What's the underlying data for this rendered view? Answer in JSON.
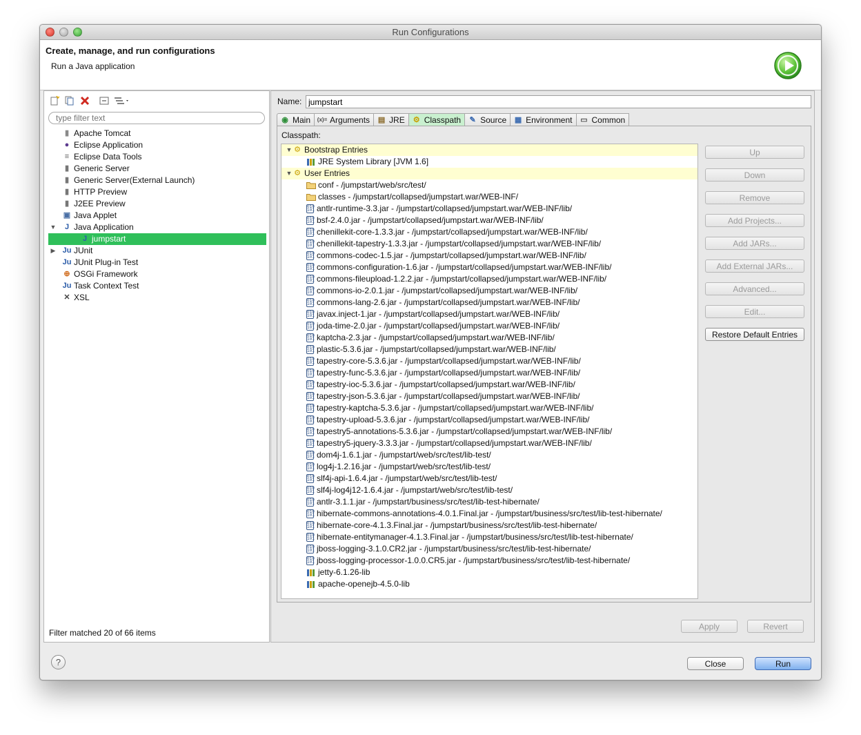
{
  "window": {
    "title": "Run Configurations"
  },
  "header": {
    "title": "Create, manage, and run configurations",
    "subtitle": "Run a Java application",
    "run_icon": "run-icon"
  },
  "sidebar": {
    "toolbar_icons": [
      "new-config-icon",
      "duplicate-icon",
      "delete-icon",
      "collapse-all-icon",
      "filter-icon"
    ],
    "filter_placeholder": "type filter text",
    "items": [
      {
        "label": "Apache Tomcat",
        "icon": "tomcat-icon",
        "level": 0,
        "twisty": ""
      },
      {
        "label": "Eclipse Application",
        "icon": "eclipse-icon",
        "level": 0,
        "twisty": ""
      },
      {
        "label": "Eclipse Data Tools",
        "icon": "database-icon",
        "level": 0,
        "twisty": ""
      },
      {
        "label": "Generic Server",
        "icon": "server-icon",
        "level": 0,
        "twisty": ""
      },
      {
        "label": "Generic Server(External Launch)",
        "icon": "server-icon",
        "level": 0,
        "twisty": ""
      },
      {
        "label": "HTTP Preview",
        "icon": "server-icon",
        "level": 0,
        "twisty": ""
      },
      {
        "label": "J2EE Preview",
        "icon": "server-icon",
        "level": 0,
        "twisty": ""
      },
      {
        "label": "Java Applet",
        "icon": "applet-icon",
        "level": 0,
        "twisty": ""
      },
      {
        "label": "Java Application",
        "icon": "java-app-icon",
        "level": 0,
        "twisty": "▼"
      },
      {
        "label": "jumpstart",
        "icon": "java-app-icon",
        "level": 1,
        "twisty": "",
        "selected": true
      },
      {
        "label": "JUnit",
        "icon": "junit-icon",
        "level": 0,
        "twisty": "▶"
      },
      {
        "label": "JUnit Plug-in Test",
        "icon": "junit-plugin-icon",
        "level": 0,
        "twisty": ""
      },
      {
        "label": "OSGi Framework",
        "icon": "osgi-icon",
        "level": 0,
        "twisty": ""
      },
      {
        "label": "Task Context Test",
        "icon": "junit-icon",
        "level": 0,
        "twisty": ""
      },
      {
        "label": "XSL",
        "icon": "xsl-icon",
        "level": 0,
        "twisty": ""
      }
    ],
    "filter_status": "Filter matched 20 of 66 items"
  },
  "main": {
    "name_label": "Name:",
    "name_value": "jumpstart",
    "tabs": [
      {
        "label": "Main",
        "icon": "main-tab-icon"
      },
      {
        "label": "Arguments",
        "icon": "arguments-icon"
      },
      {
        "label": "JRE",
        "icon": "jre-icon"
      },
      {
        "label": "Classpath",
        "icon": "classpath-icon",
        "active": true
      },
      {
        "label": "Source",
        "icon": "source-icon"
      },
      {
        "label": "Environment",
        "icon": "environment-icon"
      },
      {
        "label": "Common",
        "icon": "common-icon"
      }
    ],
    "classpath_label": "Classpath:",
    "entries": [
      {
        "label": "Bootstrap Entries",
        "kind": "group"
      },
      {
        "label": "JRE System Library [JVM 1.6]",
        "kind": "lib"
      },
      {
        "label": "User Entries",
        "kind": "group"
      },
      {
        "label": "conf - /jumpstart/web/src/test/",
        "kind": "folder"
      },
      {
        "label": "classes - /jumpstart/collapsed/jumpstart.war/WEB-INF/",
        "kind": "folder"
      },
      {
        "label": "antlr-runtime-3.3.jar - /jumpstart/collapsed/jumpstart.war/WEB-INF/lib/",
        "kind": "jar"
      },
      {
        "label": "bsf-2.4.0.jar - /jumpstart/collapsed/jumpstart.war/WEB-INF/lib/",
        "kind": "jar"
      },
      {
        "label": "chenillekit-core-1.3.3.jar - /jumpstart/collapsed/jumpstart.war/WEB-INF/lib/",
        "kind": "jar"
      },
      {
        "label": "chenillekit-tapestry-1.3.3.jar - /jumpstart/collapsed/jumpstart.war/WEB-INF/lib/",
        "kind": "jar"
      },
      {
        "label": "commons-codec-1.5.jar - /jumpstart/collapsed/jumpstart.war/WEB-INF/lib/",
        "kind": "jar"
      },
      {
        "label": "commons-configuration-1.6.jar - /jumpstart/collapsed/jumpstart.war/WEB-INF/lib/",
        "kind": "jar"
      },
      {
        "label": "commons-fileupload-1.2.2.jar - /jumpstart/collapsed/jumpstart.war/WEB-INF/lib/",
        "kind": "jar"
      },
      {
        "label": "commons-io-2.0.1.jar - /jumpstart/collapsed/jumpstart.war/WEB-INF/lib/",
        "kind": "jar"
      },
      {
        "label": "commons-lang-2.6.jar - /jumpstart/collapsed/jumpstart.war/WEB-INF/lib/",
        "kind": "jar"
      },
      {
        "label": "javax.inject-1.jar - /jumpstart/collapsed/jumpstart.war/WEB-INF/lib/",
        "kind": "jar"
      },
      {
        "label": "joda-time-2.0.jar - /jumpstart/collapsed/jumpstart.war/WEB-INF/lib/",
        "kind": "jar"
      },
      {
        "label": "kaptcha-2.3.jar - /jumpstart/collapsed/jumpstart.war/WEB-INF/lib/",
        "kind": "jar"
      },
      {
        "label": "plastic-5.3.6.jar - /jumpstart/collapsed/jumpstart.war/WEB-INF/lib/",
        "kind": "jar"
      },
      {
        "label": "tapestry-core-5.3.6.jar - /jumpstart/collapsed/jumpstart.war/WEB-INF/lib/",
        "kind": "jar"
      },
      {
        "label": "tapestry-func-5.3.6.jar - /jumpstart/collapsed/jumpstart.war/WEB-INF/lib/",
        "kind": "jar"
      },
      {
        "label": "tapestry-ioc-5.3.6.jar - /jumpstart/collapsed/jumpstart.war/WEB-INF/lib/",
        "kind": "jar"
      },
      {
        "label": "tapestry-json-5.3.6.jar - /jumpstart/collapsed/jumpstart.war/WEB-INF/lib/",
        "kind": "jar"
      },
      {
        "label": "tapestry-kaptcha-5.3.6.jar - /jumpstart/collapsed/jumpstart.war/WEB-INF/lib/",
        "kind": "jar"
      },
      {
        "label": "tapestry-upload-5.3.6.jar - /jumpstart/collapsed/jumpstart.war/WEB-INF/lib/",
        "kind": "jar"
      },
      {
        "label": "tapestry5-annotations-5.3.6.jar - /jumpstart/collapsed/jumpstart.war/WEB-INF/lib/",
        "kind": "jar"
      },
      {
        "label": "tapestry5-jquery-3.3.3.jar - /jumpstart/collapsed/jumpstart.war/WEB-INF/lib/",
        "kind": "jar"
      },
      {
        "label": "dom4j-1.6.1.jar - /jumpstart/web/src/test/lib-test/",
        "kind": "jar"
      },
      {
        "label": "log4j-1.2.16.jar - /jumpstart/web/src/test/lib-test/",
        "kind": "jar"
      },
      {
        "label": "slf4j-api-1.6.4.jar - /jumpstart/web/src/test/lib-test/",
        "kind": "jar"
      },
      {
        "label": "slf4j-log4j12-1.6.4.jar - /jumpstart/web/src/test/lib-test/",
        "kind": "jar"
      },
      {
        "label": "antlr-3.1.1.jar - /jumpstart/business/src/test/lib-test-hibernate/",
        "kind": "jar"
      },
      {
        "label": "hibernate-commons-annotations-4.0.1.Final.jar - /jumpstart/business/src/test/lib-test-hibernate/",
        "kind": "jar"
      },
      {
        "label": "hibernate-core-4.1.3.Final.jar - /jumpstart/business/src/test/lib-test-hibernate/",
        "kind": "jar"
      },
      {
        "label": "hibernate-entitymanager-4.1.3.Final.jar - /jumpstart/business/src/test/lib-test-hibernate/",
        "kind": "jar"
      },
      {
        "label": "jboss-logging-3.1.0.CR2.jar - /jumpstart/business/src/test/lib-test-hibernate/",
        "kind": "jar"
      },
      {
        "label": "jboss-logging-processor-1.0.0.CR5.jar - /jumpstart/business/src/test/lib-test-hibernate/",
        "kind": "jar"
      },
      {
        "label": "jetty-6.1.26-lib",
        "kind": "lib"
      },
      {
        "label": "apache-openejb-4.5.0-lib",
        "kind": "lib"
      }
    ],
    "side_buttons": [
      {
        "label": "Up",
        "enabled": false
      },
      {
        "label": "Down",
        "enabled": false
      },
      {
        "label": "Remove",
        "enabled": false
      },
      {
        "label": "Add Projects...",
        "enabled": false
      },
      {
        "label": "Add JARs...",
        "enabled": false
      },
      {
        "label": "Add External JARs...",
        "enabled": false
      },
      {
        "label": "Advanced...",
        "enabled": false
      },
      {
        "label": "Edit...",
        "enabled": false
      },
      {
        "label": "Restore Default Entries",
        "enabled": true
      }
    ],
    "apply_label": "Apply",
    "revert_label": "Revert"
  },
  "footer": {
    "help_glyph": "?",
    "close_label": "Close",
    "run_label": "Run"
  },
  "colors": {
    "selection": "#2fbf5a",
    "group_highlight": "#fffed1",
    "active_tab": "#c9f0cf",
    "run_button": "#7fb0ee"
  }
}
